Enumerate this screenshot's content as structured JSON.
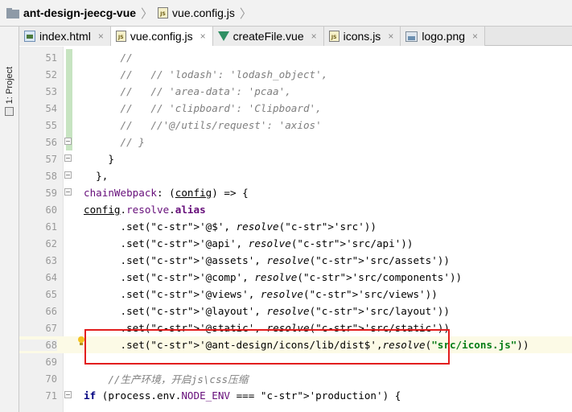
{
  "breadcrumb": {
    "project": "ant-design-jeecg-vue",
    "file": "vue.config.js",
    "file_icon_label": "JS"
  },
  "tool_window": {
    "project_label": "1: Project"
  },
  "tabs": [
    {
      "label": "index.html",
      "icon": "html-file-icon",
      "active": false
    },
    {
      "label": "vue.config.js",
      "icon": "js-file-icon",
      "active": true
    },
    {
      "label": "createFile.vue",
      "icon": "vue-file-icon",
      "active": false
    },
    {
      "label": "icons.js",
      "icon": "js-file-icon",
      "active": false
    },
    {
      "label": "logo.png",
      "icon": "png-file-icon",
      "active": false
    }
  ],
  "tab_close_glyph": "×",
  "editor": {
    "current_line": 68,
    "lines": [
      {
        "n": "51",
        "text": "      //"
      },
      {
        "n": "52",
        "text": "      //   // 'lodash': 'lodash_object',"
      },
      {
        "n": "53",
        "text": "      //   // 'area-data': 'pcaa',"
      },
      {
        "n": "54",
        "text": "      //   // 'clipboard': 'Clipboard',"
      },
      {
        "n": "55",
        "text": "      //   //'@/utils/request': 'axios'"
      },
      {
        "n": "56",
        "text": "      // }"
      },
      {
        "n": "57",
        "text": "    }"
      },
      {
        "n": "58",
        "text": "  },"
      },
      {
        "n": "59",
        "text": "  chainWebpack: (config) => {"
      },
      {
        "n": "60",
        "text": "    config.resolve.alias"
      },
      {
        "n": "61",
        "text": "      .set('@$', resolve('src'))"
      },
      {
        "n": "62",
        "text": "      .set('@api', resolve('src/api'))"
      },
      {
        "n": "63",
        "text": "      .set('@assets', resolve('src/assets'))"
      },
      {
        "n": "64",
        "text": "      .set('@comp', resolve('src/components'))"
      },
      {
        "n": "65",
        "text": "      .set('@views', resolve('src/views'))"
      },
      {
        "n": "66",
        "text": "      .set('@layout', resolve('src/layout'))"
      },
      {
        "n": "67",
        "text": "      .set('@static', resolve('src/static'))"
      },
      {
        "n": "68",
        "text": "      .set('@ant-design/icons/lib/dist$',resolve(\"src/icons.js\"))"
      },
      {
        "n": "69",
        "text": ""
      },
      {
        "n": "70",
        "text": "    //生产环境，开启js\\css压缩"
      },
      {
        "n": "71",
        "text": "    if (process.env.NODE_ENV === 'production') {"
      }
    ]
  },
  "colors": {
    "comment": "#808080",
    "string": "#067d17",
    "property": "#660e7a",
    "keyword": "#000080",
    "highlight_box": "#e21d1d",
    "current_line": "#fcfae6"
  }
}
